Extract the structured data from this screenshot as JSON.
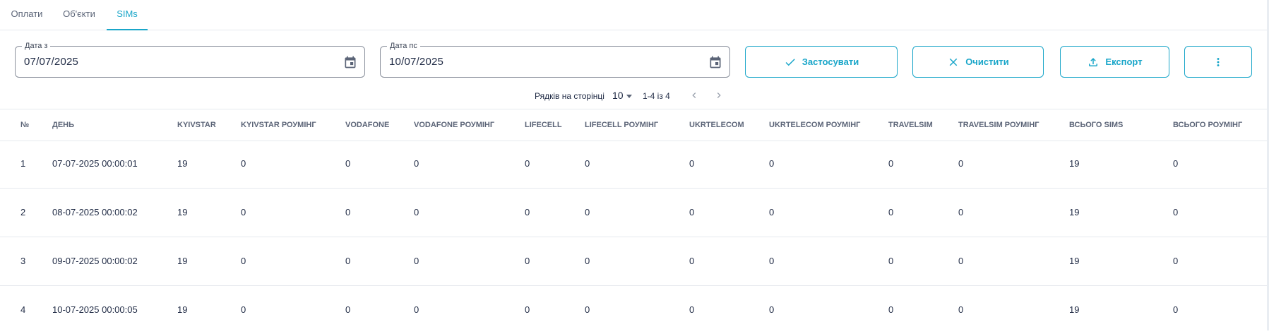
{
  "tabs": [
    {
      "label": "Оплати",
      "active": false
    },
    {
      "label": "Об'єкти",
      "active": false
    },
    {
      "label": "SIMs",
      "active": true
    }
  ],
  "filters": {
    "date_from": {
      "label": "Дата з",
      "value": "07/07/2025"
    },
    "date_to": {
      "label": "Дата пс",
      "value": "10/07/2025"
    }
  },
  "actions": {
    "apply": {
      "label": "Застосувати",
      "icon": "check-icon"
    },
    "clear": {
      "label": "Очистити",
      "icon": "close-icon"
    },
    "export": {
      "label": "Експорт",
      "icon": "upload-icon"
    },
    "more": {
      "icon": "more-vertical-icon"
    }
  },
  "pagination": {
    "rows_per_page_label": "Рядків на сторінці",
    "rows_per_page": "10",
    "range": "1-4 із 4"
  },
  "table": {
    "columns": [
      "№",
      "ДЕНЬ",
      "KYIVSTAR",
      "KYIVSTAR РОУМІНГ",
      "VODAFONE",
      "VODAFONE РОУМІНГ",
      "LIFECELL",
      "LIFECELL РОУМІНГ",
      "UKRTELECOM",
      "UKRTELECOM РОУМІНГ",
      "TRAVELSIM",
      "TRAVELSIM РОУМІНГ",
      "ВСЬОГО SIMS",
      "ВСЬОГО РОУМІНГ"
    ],
    "rows": [
      [
        "1",
        "07-07-2025 00:00:01",
        "19",
        "0",
        "0",
        "0",
        "0",
        "0",
        "0",
        "0",
        "0",
        "0",
        "19",
        "0"
      ],
      [
        "2",
        "08-07-2025 00:00:02",
        "19",
        "0",
        "0",
        "0",
        "0",
        "0",
        "0",
        "0",
        "0",
        "0",
        "19",
        "0"
      ],
      [
        "3",
        "09-07-2025 00:00:02",
        "19",
        "0",
        "0",
        "0",
        "0",
        "0",
        "0",
        "0",
        "0",
        "0",
        "19",
        "0"
      ],
      [
        "4",
        "10-07-2025 00:00:05",
        "19",
        "0",
        "0",
        "0",
        "0",
        "0",
        "0",
        "0",
        "0",
        "0",
        "19",
        "0"
      ]
    ]
  },
  "colors": {
    "accent": "#1aa6c9",
    "text": "#1f2a44",
    "muted": "#5b6477",
    "border": "#e6e9ee"
  }
}
